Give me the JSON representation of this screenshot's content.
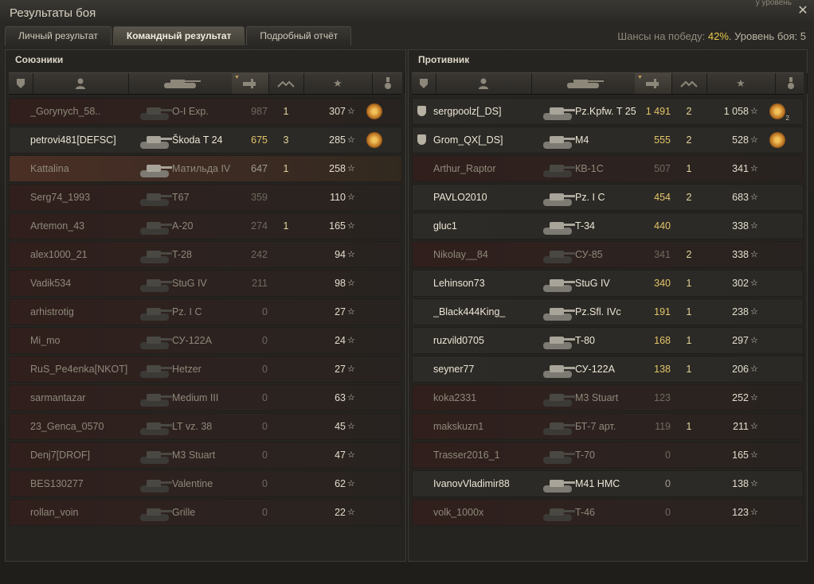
{
  "window": {
    "title": "Результаты боя",
    "toplink": "у уровень"
  },
  "tabs": [
    {
      "label": "Личный результат"
    },
    {
      "label": "Командный результат"
    },
    {
      "label": "Подробный отчёт"
    }
  ],
  "chance": {
    "prefix": "Шансы на победу: ",
    "value": "42%",
    "suffix": ". Уровень боя: 5"
  },
  "allies": {
    "title": "Союзники",
    "rows": [
      {
        "name": "_Gorynych_58..",
        "vehicle": "O-I Exp.",
        "damage": "987",
        "frags": "1",
        "xp": "307",
        "medal": true,
        "platoon": false,
        "state": "dead"
      },
      {
        "name": "petrovi481[DEFSC]",
        "vehicle": "Škoda T 24",
        "damage": "675",
        "frags": "3",
        "xp": "285",
        "medal": true,
        "platoon": false,
        "state": "alive"
      },
      {
        "name": "Kattalina",
        "vehicle": "Матильда IV",
        "damage": "647",
        "frags": "1",
        "xp": "258",
        "medal": false,
        "platoon": false,
        "state": "self"
      },
      {
        "name": "Serg74_1993",
        "vehicle": "T67",
        "damage": "359",
        "frags": "",
        "xp": "110",
        "medal": false,
        "platoon": false,
        "state": "dead"
      },
      {
        "name": "Artemon_43",
        "vehicle": "A-20",
        "damage": "274",
        "frags": "1",
        "xp": "165",
        "medal": false,
        "platoon": false,
        "state": "dead"
      },
      {
        "name": "alex1000_21",
        "vehicle": "T-28",
        "damage": "242",
        "frags": "",
        "xp": "94",
        "medal": false,
        "platoon": false,
        "state": "dead"
      },
      {
        "name": "Vadik534",
        "vehicle": "StuG IV",
        "damage": "211",
        "frags": "",
        "xp": "98",
        "medal": false,
        "platoon": false,
        "state": "dead"
      },
      {
        "name": "arhistrotig",
        "vehicle": "Pz. I C",
        "damage": "0",
        "frags": "",
        "xp": "27",
        "medal": false,
        "platoon": false,
        "state": "dead"
      },
      {
        "name": "Mi_mo",
        "vehicle": "СУ-122А",
        "damage": "0",
        "frags": "",
        "xp": "24",
        "medal": false,
        "platoon": false,
        "state": "dead"
      },
      {
        "name": "RuS_Pe4enka[NKOT]",
        "vehicle": "Hetzer",
        "damage": "0",
        "frags": "",
        "xp": "27",
        "medal": false,
        "platoon": false,
        "state": "dead"
      },
      {
        "name": "sarmantazar",
        "vehicle": "Medium III",
        "damage": "0",
        "frags": "",
        "xp": "63",
        "medal": false,
        "platoon": false,
        "state": "dead"
      },
      {
        "name": "23_Genca_0570",
        "vehicle": "LT vz. 38",
        "damage": "0",
        "frags": "",
        "xp": "45",
        "medal": false,
        "platoon": false,
        "state": "dead"
      },
      {
        "name": "Denj7[DROF]",
        "vehicle": "M3 Stuart",
        "damage": "0",
        "frags": "",
        "xp": "47",
        "medal": false,
        "platoon": false,
        "state": "dead"
      },
      {
        "name": "BES130277",
        "vehicle": "Valentine",
        "damage": "0",
        "frags": "",
        "xp": "62",
        "medal": false,
        "platoon": false,
        "state": "dead"
      },
      {
        "name": "rollan_voin",
        "vehicle": "Grille",
        "damage": "0",
        "frags": "",
        "xp": "22",
        "medal": false,
        "platoon": false,
        "state": "dead"
      }
    ]
  },
  "enemies": {
    "title": "Противник",
    "rows": [
      {
        "name": "sergpoolz[_DS]",
        "vehicle": "Pz.Kpfw. T 25",
        "damage": "1 491",
        "frags": "2",
        "xp": "1 058",
        "medal": true,
        "medal_count": "2",
        "platoon": true,
        "state": "alive"
      },
      {
        "name": "Grom_QX[_DS]",
        "vehicle": "M4",
        "damage": "555",
        "frags": "2",
        "xp": "528",
        "medal": true,
        "platoon": true,
        "state": "alive"
      },
      {
        "name": "Arthur_Raptor",
        "vehicle": "КВ-1С",
        "damage": "507",
        "frags": "1",
        "xp": "341",
        "medal": false,
        "platoon": false,
        "state": "dead"
      },
      {
        "name": "PAVLO2010",
        "vehicle": "Pz. I C",
        "damage": "454",
        "frags": "2",
        "xp": "683",
        "medal": false,
        "platoon": false,
        "state": "alive"
      },
      {
        "name": "gluc1",
        "vehicle": "T-34",
        "damage": "440",
        "frags": "",
        "xp": "338",
        "medal": false,
        "platoon": false,
        "state": "alive"
      },
      {
        "name": "Nikolay__84",
        "vehicle": "СУ-85",
        "damage": "341",
        "frags": "2",
        "xp": "338",
        "medal": false,
        "platoon": false,
        "state": "dead"
      },
      {
        "name": "Lehinson73",
        "vehicle": "StuG IV",
        "damage": "340",
        "frags": "1",
        "xp": "302",
        "medal": false,
        "platoon": false,
        "state": "alive"
      },
      {
        "name": "_Black444King_",
        "vehicle": "Pz.Sfl. IVc",
        "damage": "191",
        "frags": "1",
        "xp": "238",
        "medal": false,
        "platoon": false,
        "state": "alive"
      },
      {
        "name": "ruzvild0705",
        "vehicle": "T-80",
        "damage": "168",
        "frags": "1",
        "xp": "297",
        "medal": false,
        "platoon": false,
        "state": "alive"
      },
      {
        "name": "seyner77",
        "vehicle": "СУ-122А",
        "damage": "138",
        "frags": "1",
        "xp": "206",
        "medal": false,
        "platoon": false,
        "state": "alive"
      },
      {
        "name": "koka2331",
        "vehicle": "M3 Stuart",
        "damage": "123",
        "frags": "",
        "xp": "252",
        "medal": false,
        "platoon": false,
        "state": "dead"
      },
      {
        "name": "makskuzn1",
        "vehicle": "БТ-7 арт.",
        "damage": "119",
        "frags": "1",
        "xp": "211",
        "medal": false,
        "platoon": false,
        "state": "dead"
      },
      {
        "name": "Trasser2016_1",
        "vehicle": "T-70",
        "damage": "0",
        "frags": "",
        "xp": "165",
        "medal": false,
        "platoon": false,
        "state": "dead"
      },
      {
        "name": "IvanovVladimir88",
        "vehicle": "M41 HMC",
        "damage": "0",
        "frags": "",
        "xp": "138",
        "medal": false,
        "platoon": false,
        "state": "alive"
      },
      {
        "name": "volk_1000x",
        "vehicle": "T-46",
        "damage": "0",
        "frags": "",
        "xp": "123",
        "medal": false,
        "platoon": false,
        "state": "dead"
      }
    ]
  },
  "colors": {
    "accent": "#e6c84a",
    "self_row": "#4a2f24"
  },
  "icons": [
    "close-icon",
    "platoon-icon",
    "player-icon",
    "tank-icon",
    "damage-icon",
    "frags-icon",
    "xp-star-icon",
    "medal-icon"
  ]
}
